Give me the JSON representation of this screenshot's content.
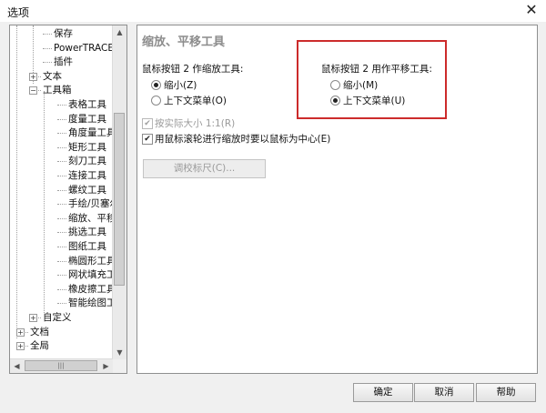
{
  "window": {
    "title": "选项",
    "close_glyph": "✕"
  },
  "tree": {
    "items": [
      {
        "label": "保存",
        "name": "tree-item-save"
      },
      {
        "label": "PowerTRACE",
        "name": "tree-item-powertrace"
      },
      {
        "label": "插件",
        "name": "tree-item-plugins"
      },
      {
        "label": "文本",
        "name": "tree-item-text",
        "expander": "+"
      },
      {
        "label": "工具箱",
        "name": "tree-item-toolbox",
        "expander": "−"
      },
      {
        "label": "表格工具",
        "name": "tree-item-table-tool"
      },
      {
        "label": "度量工具",
        "name": "tree-item-measure-tool"
      },
      {
        "label": "角度量工具",
        "name": "tree-item-angle-tool"
      },
      {
        "label": "矩形工具",
        "name": "tree-item-rect-tool"
      },
      {
        "label": "刻刀工具",
        "name": "tree-item-knife-tool"
      },
      {
        "label": "连接工具",
        "name": "tree-item-connector-tool"
      },
      {
        "label": "螺纹工具",
        "name": "tree-item-spiral-tool"
      },
      {
        "label": "手绘/贝塞尔工",
        "name": "tree-item-bezier-tool"
      },
      {
        "label": "缩放、平移工",
        "name": "tree-item-zoom-pan-tool"
      },
      {
        "label": "挑选工具",
        "name": "tree-item-pick-tool"
      },
      {
        "label": "图纸工具",
        "name": "tree-item-graph-paper-tool"
      },
      {
        "label": "椭圆形工具",
        "name": "tree-item-ellipse-tool"
      },
      {
        "label": "网状填充工具",
        "name": "tree-item-mesh-tool"
      },
      {
        "label": "橡皮擦工具",
        "name": "tree-item-eraser-tool"
      },
      {
        "label": "智能绘图工具",
        "name": "tree-item-smart-draw-tool"
      },
      {
        "label": "自定义",
        "name": "tree-item-customize",
        "expander": "+"
      },
      {
        "label": "文档",
        "name": "tree-item-document",
        "expander": "+"
      },
      {
        "label": "全局",
        "name": "tree-item-global",
        "expander": "+"
      }
    ],
    "hscroll_grip": "|||",
    "arrow_up": "▲",
    "arrow_down": "▼",
    "arrow_left": "◀",
    "arrow_right": "▶"
  },
  "panel": {
    "heading": "缩放、平移工具",
    "zoom_group": {
      "label": "鼠标按钮 2 作缩放工具:",
      "option1": "缩小(Z)",
      "option2": "上下文菜单(O)",
      "selected": "option1"
    },
    "pan_group": {
      "label": "鼠标按钮 2 用作平移工具:",
      "option1": "缩小(M)",
      "option2": "上下文菜单(U)",
      "selected": "option2"
    },
    "actual_size": {
      "label": "按实际大小 1:1(R)",
      "checked": true,
      "disabled": true
    },
    "center_on_mouse": {
      "label": "用鼠标滚轮进行缩放时要以鼠标为中心(E)",
      "checked": true
    },
    "calibrate_label": "调校标尺(C)...",
    "check_glyph": "✔"
  },
  "buttons": {
    "ok": "确定",
    "cancel": "取消",
    "help": "帮助"
  },
  "colors": {
    "highlight_border": "#cc2b2b"
  }
}
